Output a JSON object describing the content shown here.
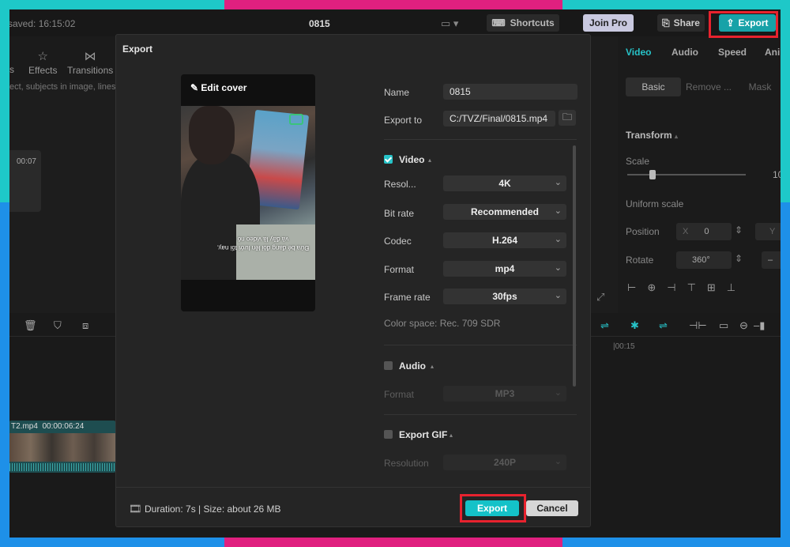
{
  "colors": {
    "accent": "#27c3c8",
    "danger_outline": "#e8222e",
    "border_teal": "#1ec8c8",
    "border_pink": "#e0207f",
    "border_blue": "#1e90e8"
  },
  "topbar": {
    "saved": "saved: 16:15:02",
    "title": "0815",
    "shortcuts": "Shortcuts",
    "join_pro": "Join Pro",
    "share": "Share",
    "export": "Export"
  },
  "left": {
    "tools": [
      "rs",
      "Effects",
      "Transitions"
    ],
    "hint": "ect, subjects in image, lines",
    "clip_time": "00:07"
  },
  "right": {
    "tabs": [
      "Video",
      "Audio",
      "Speed",
      "Ani"
    ],
    "subtabs": [
      "Basic",
      "Remove ...",
      "Mask"
    ],
    "transform": "Transform",
    "scale": "Scale",
    "scale_val": "10",
    "uniform_scale": "Uniform scale",
    "position": "Position",
    "pos_x_label": "X",
    "pos_x": "0",
    "pos_y_label": "Y",
    "rotate": "Rotate",
    "rotate_val": "360°"
  },
  "timeline": {
    "time": "|00:15",
    "clip_name": "T2.mp4",
    "clip_dur": "00:00:06:24"
  },
  "dialog": {
    "title": "Export",
    "edit_cover": "Edit cover",
    "caption": "Đứa bé đang đòi lên lưới tối nay, và đây là video nó",
    "name_label": "Name",
    "name_value": "0815",
    "exportto_label": "Export to",
    "exportto_value": "C:/TVZ/Final/0815.mp4",
    "video": {
      "label": "Video",
      "checked": true,
      "fields": [
        {
          "label": "Resol...",
          "value": "4K"
        },
        {
          "label": "Bit rate",
          "value": "Recommended"
        },
        {
          "label": "Codec",
          "value": "H.264"
        },
        {
          "label": "Format",
          "value": "mp4"
        },
        {
          "label": "Frame rate",
          "value": "30fps"
        }
      ],
      "color_space": "Color space: Rec. 709 SDR"
    },
    "audio": {
      "label": "Audio",
      "checked": false,
      "format_label": "Format",
      "format_value": "MP3"
    },
    "gif": {
      "label": "Export GIF",
      "checked": false,
      "res_label": "Resolution",
      "res_value": "240P"
    },
    "footer": {
      "info": "Duration: 7s | Size: about 26 MB",
      "export": "Export",
      "cancel": "Cancel"
    }
  }
}
